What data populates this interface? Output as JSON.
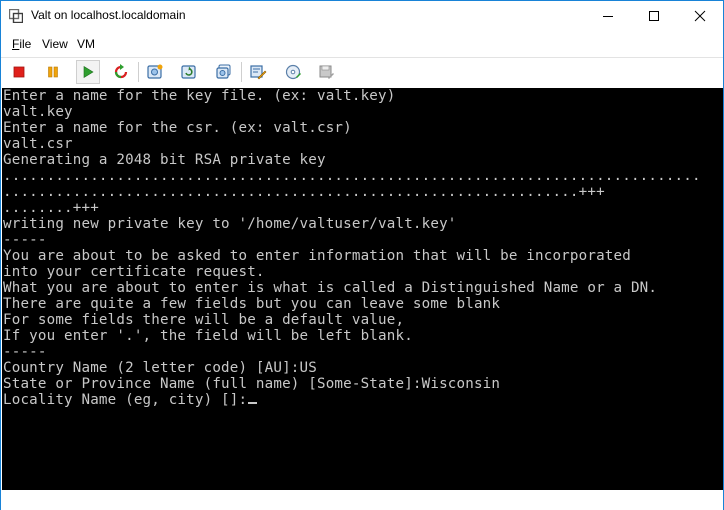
{
  "window": {
    "title": "Valt on localhost.localdomain",
    "app_icon": "vmware-icon",
    "controls": [
      "minimize-icon",
      "maximize-icon",
      "close-icon"
    ]
  },
  "menu": [
    {
      "key": "F",
      "rest": "ile"
    },
    {
      "key": "",
      "rest": "View"
    },
    {
      "key": "",
      "rest": "VM"
    }
  ],
  "toolbar": {
    "buttons": [
      {
        "name": "power-off-button",
        "icon": "stop-square-icon"
      },
      {
        "name": "suspend-button",
        "icon": "pause-icon"
      },
      {
        "name": "power-on-button",
        "icon": "play-icon"
      },
      {
        "name": "reset-button",
        "icon": "reset-icon"
      },
      {
        "name": "snapshot-button",
        "icon": "snapshot-icon"
      },
      {
        "name": "revert-snapshot-button",
        "icon": "revert-snapshot-icon"
      },
      {
        "name": "manage-snapshots-button",
        "icon": "manage-snapshots-icon"
      },
      {
        "name": "edit-settings-button",
        "icon": "edit-settings-icon"
      },
      {
        "name": "connect-cd-button",
        "icon": "cd-icon"
      },
      {
        "name": "connect-floppy-button",
        "icon": "floppy-icon"
      }
    ],
    "colors": {
      "stop": "#e0201b",
      "pause": "#f0a30a",
      "play": "#2e9e2e"
    }
  },
  "console": {
    "lines": [
      "Enter a name for the key file. (ex: valt.key)",
      "valt.key",
      "Enter a name for the csr. (ex: valt.csr)",
      "valt.csr",
      "Generating a 2048 bit RSA private key",
      "................................................................................",
      "..................................................................+++",
      "........+++",
      "writing new private key to '/home/valtuser/valt.key'",
      "-----",
      "You are about to be asked to enter information that will be incorporated",
      "into your certificate request.",
      "What you are about to enter is what is called a Distinguished Name or a DN.",
      "There are quite a few fields but you can leave some blank",
      "For some fields there will be a default value,",
      "If you enter '.', the field will be left blank.",
      "-----",
      "Country Name (2 letter code) [AU]:US",
      "State or Province Name (full name) [Some-State]:Wisconsin",
      "Locality Name (eg, city) []:"
    ],
    "background": "#000000",
    "foreground": "#c8c8c8"
  }
}
